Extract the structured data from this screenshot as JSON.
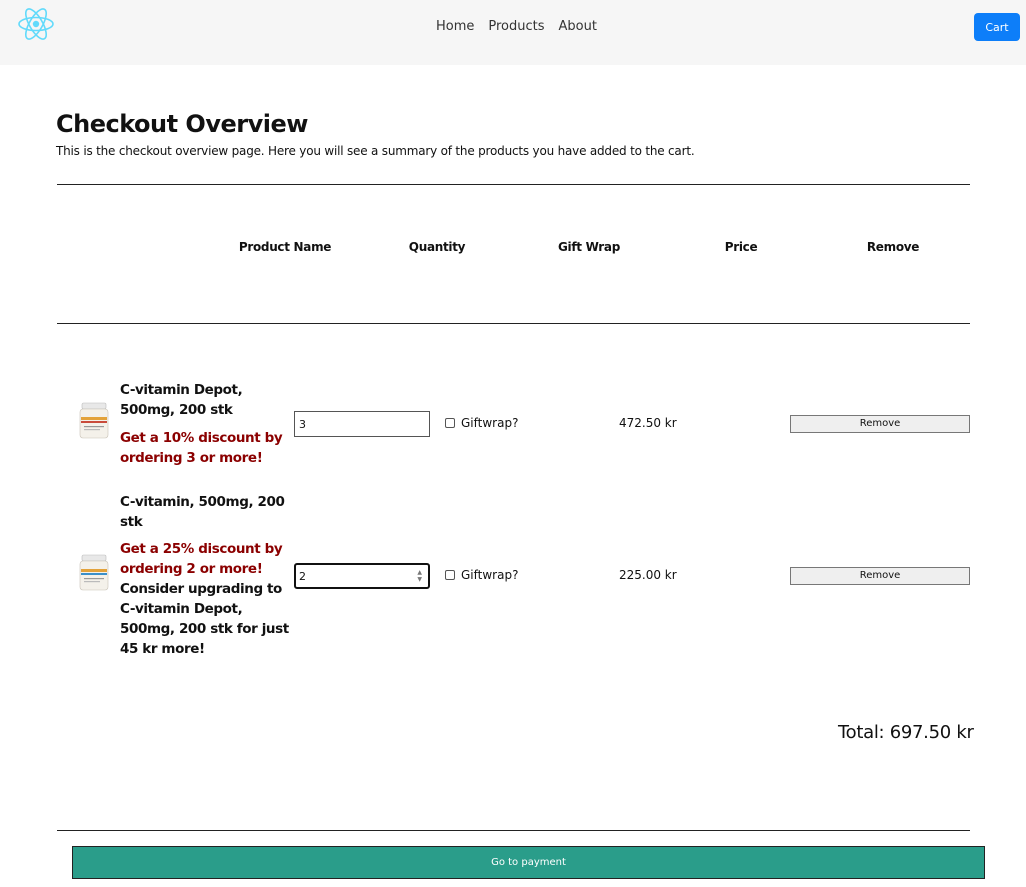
{
  "nav": {
    "logo_icon": "react-atom-icon",
    "links": [
      "Home",
      "Products",
      "About"
    ],
    "cart_label": "Cart",
    "cart_color": "#0d7ef9"
  },
  "page": {
    "title": "Checkout Overview",
    "description": "This is the checkout overview page. Here you will see a summary of the products you have added to the cart."
  },
  "table": {
    "headers": [
      "Product Name",
      "Quantity",
      "Gift Wrap",
      "Price",
      "Remove"
    ],
    "rows": [
      {
        "name": "C-vitamin Depot, 500mg, 200 stk",
        "promo": "Get a 10% discount by ordering 3 or more!",
        "upsell": "",
        "quantity": "3",
        "giftwrap_label": "Giftwrap?",
        "giftwrap_checked": false,
        "price": "472.50 kr",
        "remove_label": "Remove"
      },
      {
        "name": "C-vitamin, 500mg, 200 stk",
        "promo": "Get a 25% discount by ordering 2 or more!",
        "upsell": "Consider upgrading to C-vitamin Depot, 500mg, 200 stk for just 45 kr more!",
        "quantity": "2",
        "giftwrap_label": "Giftwrap?",
        "giftwrap_checked": false,
        "price": "225.00 kr",
        "remove_label": "Remove"
      }
    ]
  },
  "summary": {
    "total": "Total: 697.50 kr"
  },
  "payment": {
    "button_label": "Go to payment",
    "button_color": "#2a9d8a"
  },
  "colors": {
    "promo_text": "#8b0000",
    "navbar_bg": "#f6f6f6"
  }
}
